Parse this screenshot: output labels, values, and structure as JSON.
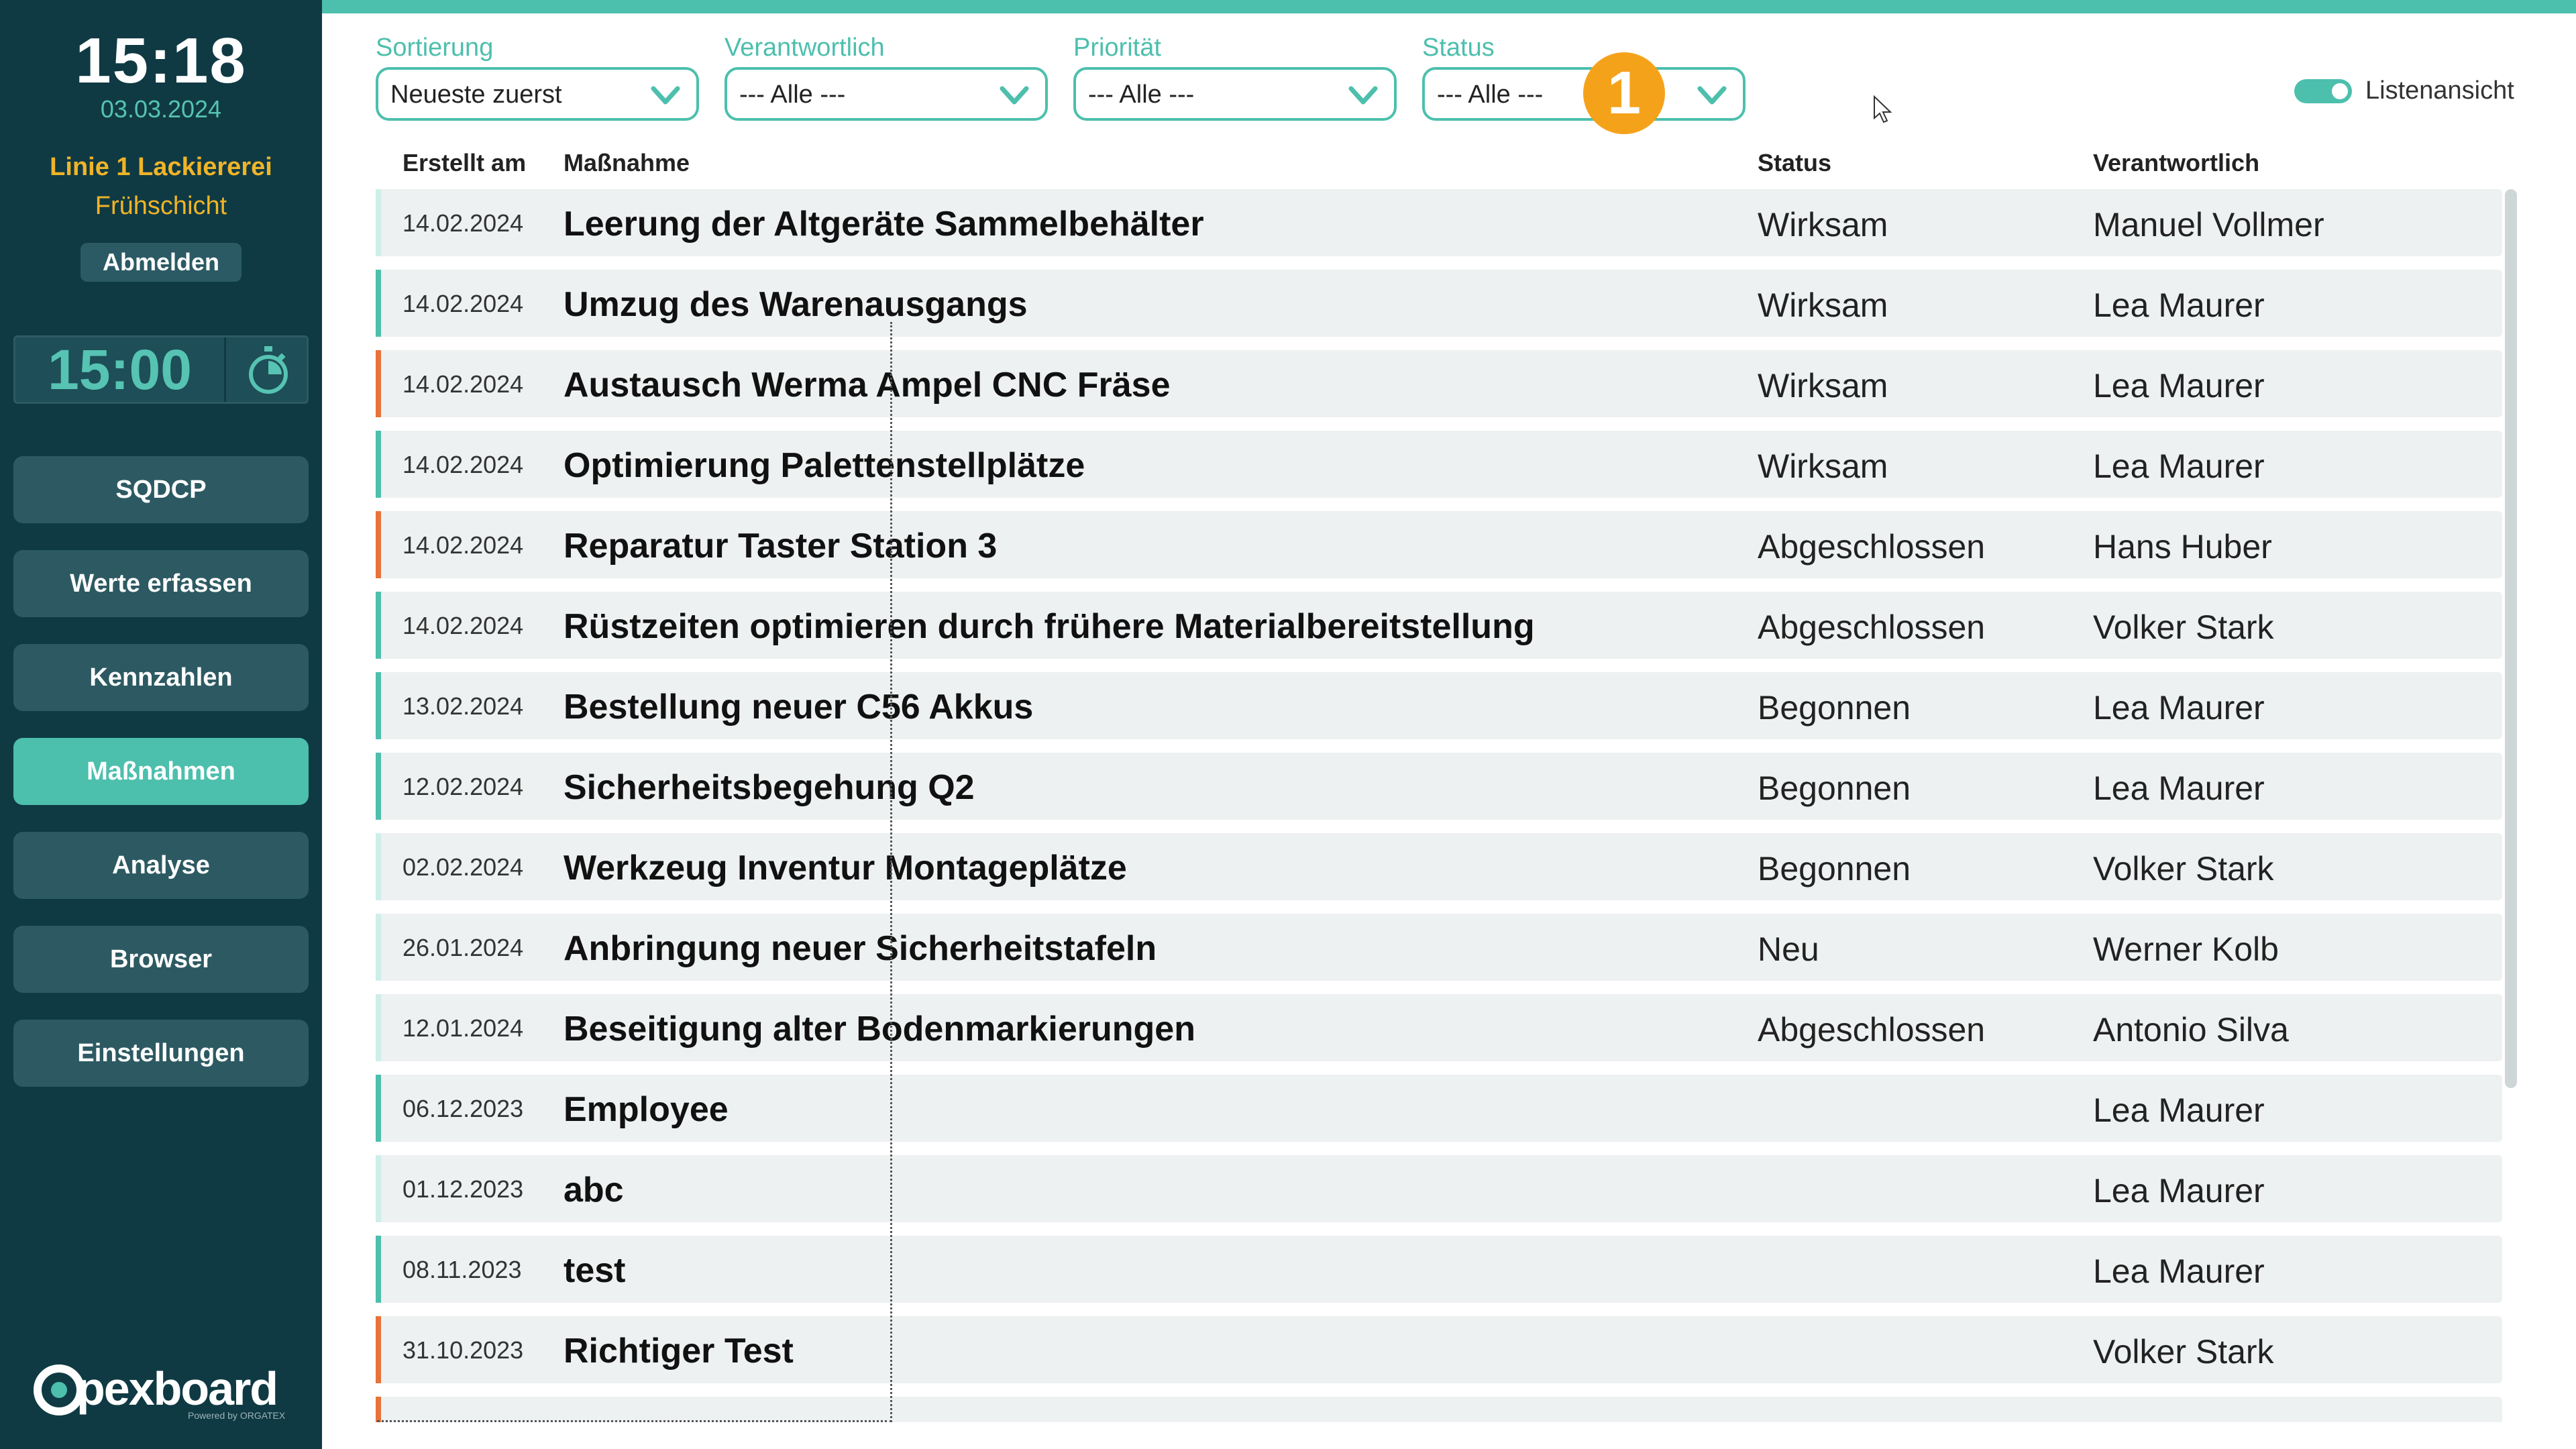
{
  "sidebar": {
    "clock": "15:18",
    "date": "03.03.2024",
    "line": "Linie 1 Lackiererei",
    "shift": "Frühschicht",
    "logout_label": "Abmelden",
    "timer": "15:00",
    "nav": [
      {
        "label": "SQDCP"
      },
      {
        "label": "Werte erfassen"
      },
      {
        "label": "Kennzahlen"
      },
      {
        "label": "Maßnahmen"
      },
      {
        "label": "Analyse"
      },
      {
        "label": "Browser"
      },
      {
        "label": "Einstellungen"
      }
    ],
    "logo": "pexboard",
    "logo_sub": "Powered by ORGATEX"
  },
  "filters": {
    "sort": {
      "label": "Sortierung",
      "value": "Neueste zuerst"
    },
    "responsible": {
      "label": "Verantwortlich",
      "value": "--- Alle ---"
    },
    "priority": {
      "label": "Priorität",
      "value": "--- Alle ---"
    },
    "status": {
      "label": "Status",
      "value": "--- Alle ---"
    },
    "badge": "1",
    "list_view_label": "Listenansicht"
  },
  "table": {
    "headers": {
      "created": "Erstellt am",
      "measure": "Maßnahme",
      "status": "Status",
      "responsible": "Verantwortlich"
    },
    "rows": [
      {
        "date": "14.02.2024",
        "title": "Leerung der Altgeräte Sammelbehälter",
        "status": "Wirksam",
        "responsible": "Manuel Vollmer",
        "color": "#cfeee9"
      },
      {
        "date": "14.02.2024",
        "title": "Umzug des Warenausgangs",
        "status": "Wirksam",
        "responsible": "Lea Maurer",
        "color": "#4dbfad"
      },
      {
        "date": "14.02.2024",
        "title": "Austausch Werma Ampel CNC Fräse",
        "status": "Wirksam",
        "responsible": "Lea Maurer",
        "color": "#e8733a"
      },
      {
        "date": "14.02.2024",
        "title": "Optimierung Palettenstellplätze",
        "status": "Wirksam",
        "responsible": "Lea Maurer",
        "color": "#4dbfad"
      },
      {
        "date": "14.02.2024",
        "title": "Reparatur Taster Station 3",
        "status": "Abgeschlossen",
        "responsible": "Hans Huber",
        "color": "#e8733a"
      },
      {
        "date": "14.02.2024",
        "title": "Rüstzeiten optimieren durch frühere Materialbereitstellung",
        "status": "Abgeschlossen",
        "responsible": "Volker Stark",
        "color": "#4dbfad"
      },
      {
        "date": "13.02.2024",
        "title": "Bestellung neuer C56 Akkus",
        "status": "Begonnen",
        "responsible": "Lea Maurer",
        "color": "#4dbfad"
      },
      {
        "date": "12.02.2024",
        "title": "Sicherheitsbegehung Q2",
        "status": "Begonnen",
        "responsible": "Lea Maurer",
        "color": "#4dbfad"
      },
      {
        "date": "02.02.2024",
        "title": "Werkzeug Inventur Montageplätze",
        "status": "Begonnen",
        "responsible": "Volker Stark",
        "color": "#cfeee9"
      },
      {
        "date": "26.01.2024",
        "title": "Anbringung neuer Sicherheitstafeln",
        "status": "Neu",
        "responsible": "Werner Kolb",
        "color": "#cfeee9"
      },
      {
        "date": "12.01.2024",
        "title": "Beseitigung alter Bodenmarkierungen",
        "status": "Abgeschlossen",
        "responsible": "Antonio Silva",
        "color": "#cfeee9"
      },
      {
        "date": "06.12.2023",
        "title": "Employee",
        "status": "",
        "responsible": "Lea Maurer",
        "color": "#4dbfad"
      },
      {
        "date": "01.12.2023",
        "title": "abc",
        "status": "",
        "responsible": "Lea Maurer",
        "color": "#cfeee9"
      },
      {
        "date": "08.11.2023",
        "title": "test",
        "status": "",
        "responsible": "Lea Maurer",
        "color": "#4dbfad"
      },
      {
        "date": "31.10.2023",
        "title": "Richtiger Test",
        "status": "",
        "responsible": "Volker Stark",
        "color": "#e8733a"
      },
      {
        "date": "",
        "title": "",
        "status": "",
        "responsible": "",
        "color": "#e8733a"
      }
    ]
  }
}
